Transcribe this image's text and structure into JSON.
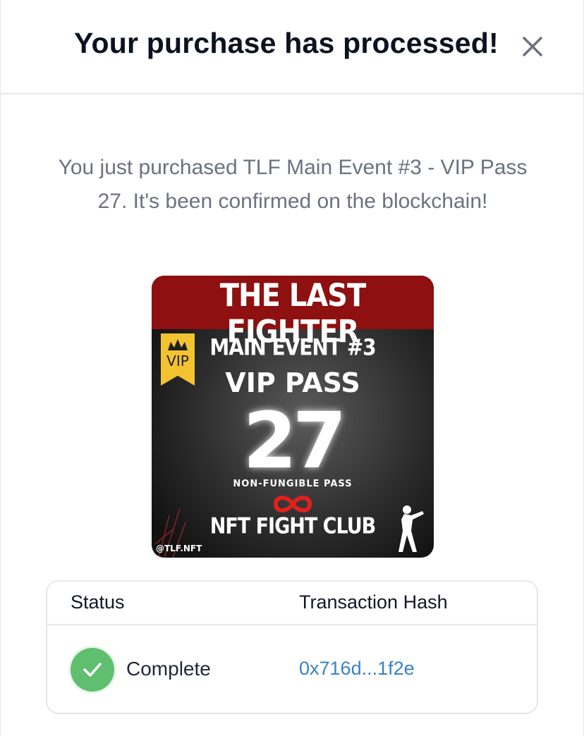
{
  "modal": {
    "title": "Your purchase has processed!",
    "message": "You just purchased TLF Main Event #3 - VIP Pass 27. It's been confirmed on the blockchain!"
  },
  "nft_image": {
    "brand": "THE LAST FIGHTER",
    "event": "MAIN EVENT #3",
    "pass": "VIP PASS",
    "number": "27",
    "subtitle": "NON-FUNGIBLE PASS",
    "club": "NFT FIGHT CLUB",
    "handle": "@TLF.NFT",
    "badge": "VIP"
  },
  "table": {
    "headers": {
      "status": "Status",
      "hash": "Transaction Hash"
    },
    "row": {
      "status": "Complete",
      "hash": "0x716d...1f2e"
    }
  },
  "colors": {
    "success": "#5fbf6f",
    "link": "#3b82c4",
    "banner": "#8e1010",
    "infinity": "#e0201d",
    "badge": "#f2c230"
  },
  "icons": {
    "close": "close-icon",
    "status": "check-circle-icon"
  }
}
